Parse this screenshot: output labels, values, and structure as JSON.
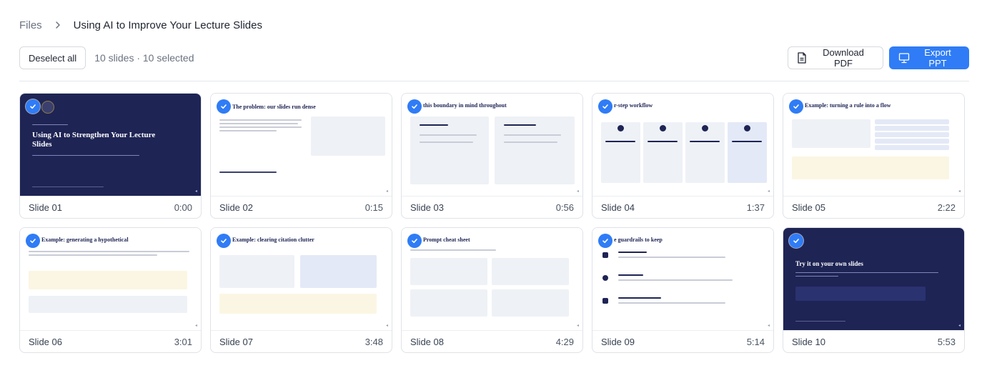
{
  "breadcrumb": {
    "root": "Files",
    "current": "Using AI to Improve Your Lecture Slides"
  },
  "toolbar": {
    "deselect_label": "Deselect all",
    "selection_status": "10 slides · 10 selected",
    "download_pdf_label": "Download PDF",
    "export_ppt_label": "Export PPT"
  },
  "colors": {
    "accent": "#2f7cf6",
    "navy": "#1e2454"
  },
  "slides": [
    {
      "label": "Slide 01",
      "time": "0:00",
      "title": "Using AI to Strengthen Your Lecture Slides",
      "theme": "dark"
    },
    {
      "label": "Slide 02",
      "time": "0:15",
      "title": "The problem: our slides run dense",
      "theme": "light"
    },
    {
      "label": "Slide 03",
      "time": "0:56",
      "title": "this boundary in mind throughout",
      "theme": "light"
    },
    {
      "label": "Slide 04",
      "time": "1:37",
      "title": "r-step workflow",
      "theme": "light"
    },
    {
      "label": "Slide 05",
      "time": "2:22",
      "title": "Example: turning a rule into a flow",
      "theme": "light"
    },
    {
      "label": "Slide 06",
      "time": "3:01",
      "title": "Example: generating a hypothetical",
      "theme": "light"
    },
    {
      "label": "Slide 07",
      "time": "3:48",
      "title": "Example: clearing citation clutter",
      "theme": "light"
    },
    {
      "label": "Slide 08",
      "time": "4:29",
      "title": "Prompt cheat sheet",
      "theme": "light"
    },
    {
      "label": "Slide 09",
      "time": "5:14",
      "title": "e guardrails to keep",
      "theme": "light"
    },
    {
      "label": "Slide 10",
      "time": "5:53",
      "title": "Try it on your own slides",
      "theme": "dark"
    }
  ]
}
